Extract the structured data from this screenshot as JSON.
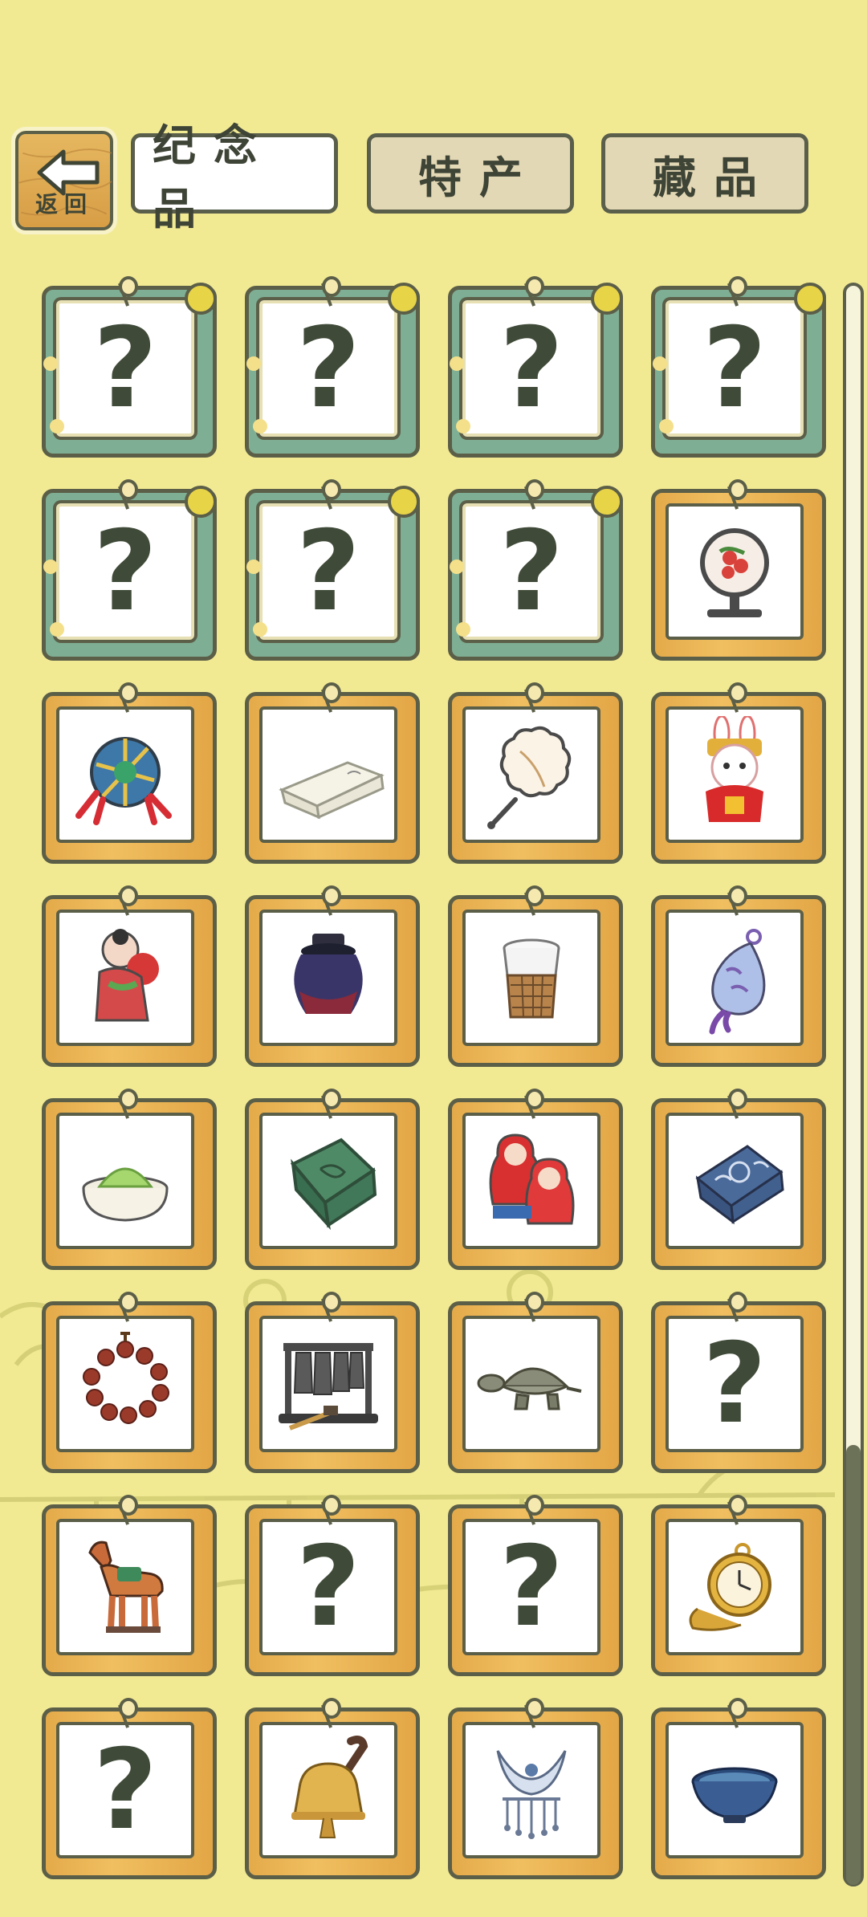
{
  "nav": {
    "back_label": "返回",
    "tabs": [
      {
        "label": "纪念品",
        "active": true
      },
      {
        "label": "特产",
        "active": false
      },
      {
        "label": "藏品",
        "active": false
      }
    ]
  },
  "colors": {
    "background": "#f2ea93",
    "locked_frame": "#7eae94",
    "known_frame": "#e4aa4a",
    "outline": "#5c5f48"
  },
  "items": [
    {
      "state": "locked",
      "icon": "question-mark"
    },
    {
      "state": "locked",
      "icon": "question-mark"
    },
    {
      "state": "locked",
      "icon": "question-mark"
    },
    {
      "state": "locked",
      "icon": "question-mark"
    },
    {
      "state": "locked",
      "icon": "question-mark"
    },
    {
      "state": "locked",
      "icon": "question-mark"
    },
    {
      "state": "locked",
      "icon": "question-mark"
    },
    {
      "state": "known",
      "icon": "embroidery-screen-icon"
    },
    {
      "state": "known",
      "icon": "temari-ball-icon"
    },
    {
      "state": "known",
      "icon": "folded-cloth-icon"
    },
    {
      "state": "known",
      "icon": "round-fan-icon"
    },
    {
      "state": "known",
      "icon": "rabbit-figurine-icon"
    },
    {
      "state": "known",
      "icon": "clay-doll-icon"
    },
    {
      "state": "known",
      "icon": "wine-jar-icon"
    },
    {
      "state": "known",
      "icon": "bamboo-cup-icon"
    },
    {
      "state": "known",
      "icon": "sachet-icon"
    },
    {
      "state": "known",
      "icon": "matcha-bowl-icon"
    },
    {
      "state": "known",
      "icon": "jade-plaque-icon"
    },
    {
      "state": "known",
      "icon": "matryoshka-icon"
    },
    {
      "state": "known",
      "icon": "blue-scarf-icon"
    },
    {
      "state": "known",
      "icon": "prayer-beads-icon"
    },
    {
      "state": "known",
      "icon": "chime-bells-icon"
    },
    {
      "state": "known",
      "icon": "stone-turtle-icon"
    },
    {
      "state": "unknown",
      "icon": "question-mark"
    },
    {
      "state": "known",
      "icon": "tang-horse-icon"
    },
    {
      "state": "unknown",
      "icon": "question-mark"
    },
    {
      "state": "unknown",
      "icon": "question-mark"
    },
    {
      "state": "known",
      "icon": "pocket-watch-icon"
    },
    {
      "state": "unknown",
      "icon": "question-mark"
    },
    {
      "state": "known",
      "icon": "bell-icon"
    },
    {
      "state": "known",
      "icon": "silver-lock-icon"
    },
    {
      "state": "known",
      "icon": "tea-bowl-icon"
    }
  ]
}
